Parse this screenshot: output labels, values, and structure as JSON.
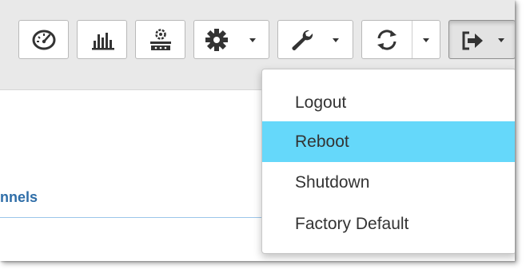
{
  "toolbar": {
    "buttons": [
      {
        "icon": "dashboard-gauge-icon"
      },
      {
        "icon": "bar-chart-icon"
      },
      {
        "icon": "device-config-icon"
      },
      {
        "icon": "gear-icon",
        "has_dropdown": true
      },
      {
        "icon": "wrench-icon",
        "has_dropdown": true
      },
      {
        "icon": "refresh-icon",
        "has_dropdown": true,
        "split": true
      },
      {
        "icon": "sign-out-icon",
        "has_dropdown": true,
        "active": true
      }
    ]
  },
  "content": {
    "section_label": "nnels"
  },
  "dropdown_menu": {
    "items": [
      {
        "label": "Logout",
        "highlighted": false
      },
      {
        "label": "Reboot",
        "highlighted": true
      },
      {
        "label": "Shutdown",
        "highlighted": false
      },
      {
        "label": "Factory Default",
        "highlighted": false
      }
    ],
    "highlight_color": "#65d8fa"
  },
  "colors": {
    "toolbar_bg": "#e9e9e9",
    "heading_blue": "#2f6ea8",
    "rule_blue": "#9cc6ea",
    "text": "#333333"
  }
}
